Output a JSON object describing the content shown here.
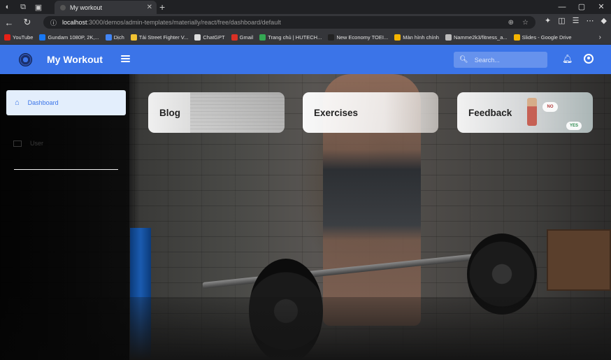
{
  "browser": {
    "tab_title": "My workout",
    "url_host": "localhost",
    "url_path": ":3000/demos/admin-templates/materially/react/free/dashboard/default",
    "bookmarks": [
      {
        "label": "YouTube",
        "color": "#e62117"
      },
      {
        "label": "Gundam 1080P, 2K,...",
        "color": "#1877f2"
      },
      {
        "label": "Dịch",
        "color": "#4285f4"
      },
      {
        "label": "Tải Street Fighter V...",
        "color": "#f1c232"
      },
      {
        "label": "ChatGPT",
        "color": "#ddd"
      },
      {
        "label": "Gmail",
        "color": "#d93025"
      },
      {
        "label": "Trang chủ | HUTECH...",
        "color": "#34a853"
      },
      {
        "label": "New Economy TOEI...",
        "color": "#222"
      },
      {
        "label": "Màn hình chính",
        "color": "#f4b400"
      },
      {
        "label": "Namme2k3/fitness_a...",
        "color": "#bbb"
      },
      {
        "label": "Slides - Google Drive",
        "color": "#f4b400"
      }
    ]
  },
  "header": {
    "brand": "My Workout",
    "search_placeholder": "Search...",
    "accent_color": "#3b74e8"
  },
  "sidebar": {
    "items": [
      {
        "label": "Dashboard",
        "icon": "home-icon",
        "active": true
      },
      {
        "label": "User",
        "icon": "user-card-icon",
        "active": false
      }
    ]
  },
  "cards": [
    {
      "title": "Blog"
    },
    {
      "title": "Exercises"
    },
    {
      "title": "Feedback"
    }
  ],
  "feedback_badges": {
    "no": "NO",
    "yes": "YES"
  }
}
